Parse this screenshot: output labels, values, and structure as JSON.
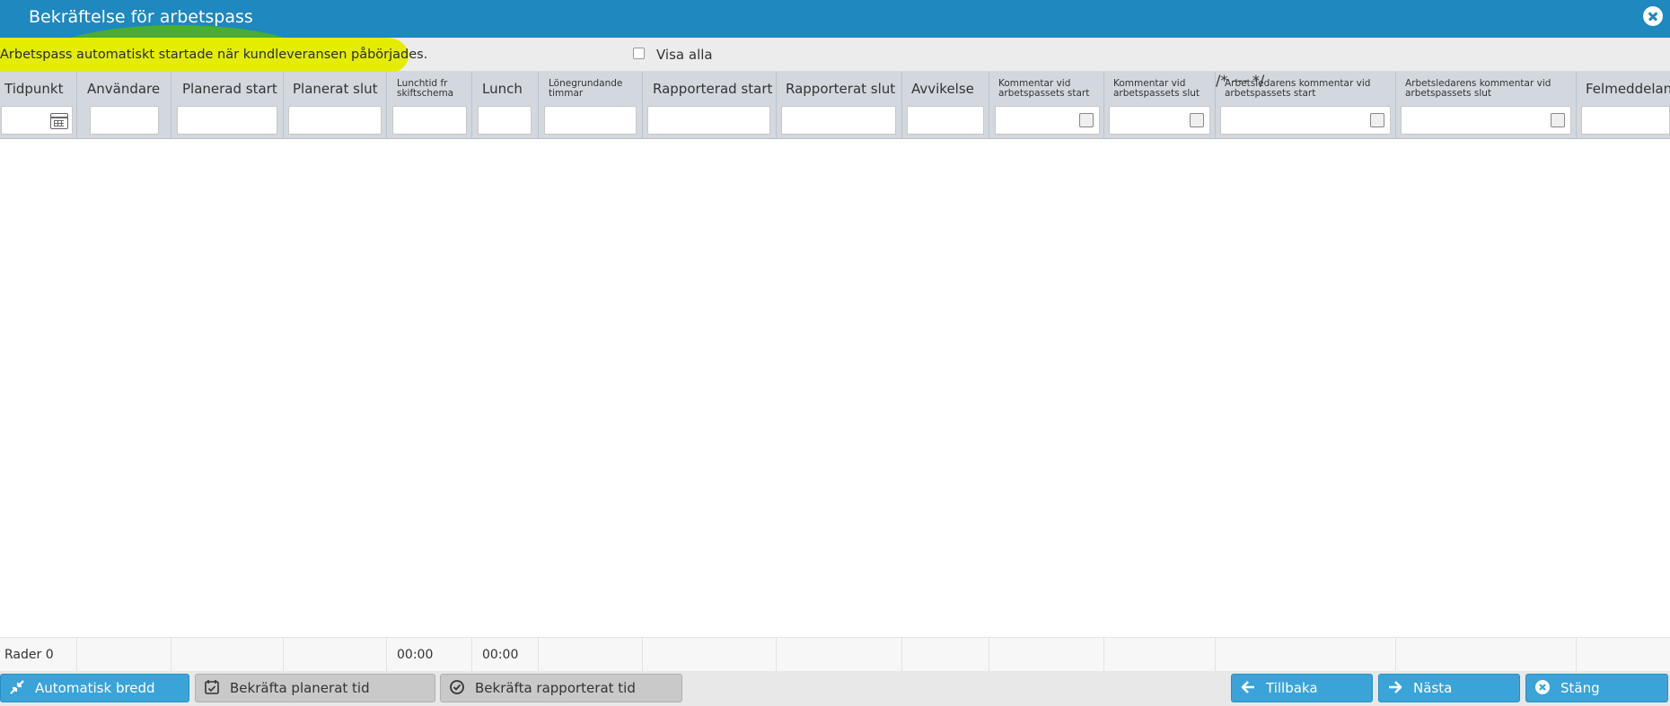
{
  "window": {
    "title": "Bekräftelse för arbetspass"
  },
  "infobar": {
    "message": "Arbetspass automatiskt startade när kundleveransen påbörjades.",
    "visa_alla_label": "Visa alla",
    "highlight_colors": {
      "yellow": "#e4ed00",
      "green": "#4caf2a"
    }
  },
  "grid": {
    "columns": [
      {
        "label": "Tidpunkt",
        "filter": "date"
      },
      {
        "label": "Användare",
        "filter": "text"
      },
      {
        "label": "Planerad start",
        "filter": "text"
      },
      {
        "label": "Planerat slut",
        "filter": "text"
      },
      {
        "label": "Lunchtid fr skiftschema",
        "filter": "text"
      },
      {
        "label": "Lunch",
        "filter": "text"
      },
      {
        "label": "Lönegrundande timmar",
        "filter": "text"
      },
      {
        "label": "Rapporterad start",
        "filter": "text"
      },
      {
        "label": "Rapporterat slut",
        "filter": "text"
      },
      {
        "label": "Avvikelse",
        "filter": "text"
      },
      {
        "label": "Kommentar vid arbetspassets start",
        "filter": "checkbox"
      },
      {
        "label": "Kommentar vid arbetspassets slut",
        "filter": "checkbox"
      },
      {
        "label": "Arbetsledarens kommentar vid arbetspassets start",
        "filter": "checkbox"
      },
      {
        "label": "Arbetsledarens kommentar vid arbetspassets slut",
        "filter": "checkbox"
      },
      {
        "label": "Felmeddeland",
        "filter": "text"
      }
    ],
    "footer": {
      "rows_label": "Rader 0",
      "lunchtid_total": "00:00",
      "lunch_total": "00:00"
    }
  },
  "toolbar": {
    "auto_width": "Automatisk bredd",
    "confirm_planned": "Bekräfta planerat tid",
    "confirm_reported": "Bekräfta rapporterat tid",
    "back": "Tillbaka",
    "next": "Nästa",
    "close": "Stäng"
  },
  "colors": {
    "titlebar": "#1e88bf",
    "button_blue": "#3aa3d8",
    "button_grey": "#c9c9c9",
    "header_bg": "#d3d8de"
  }
}
